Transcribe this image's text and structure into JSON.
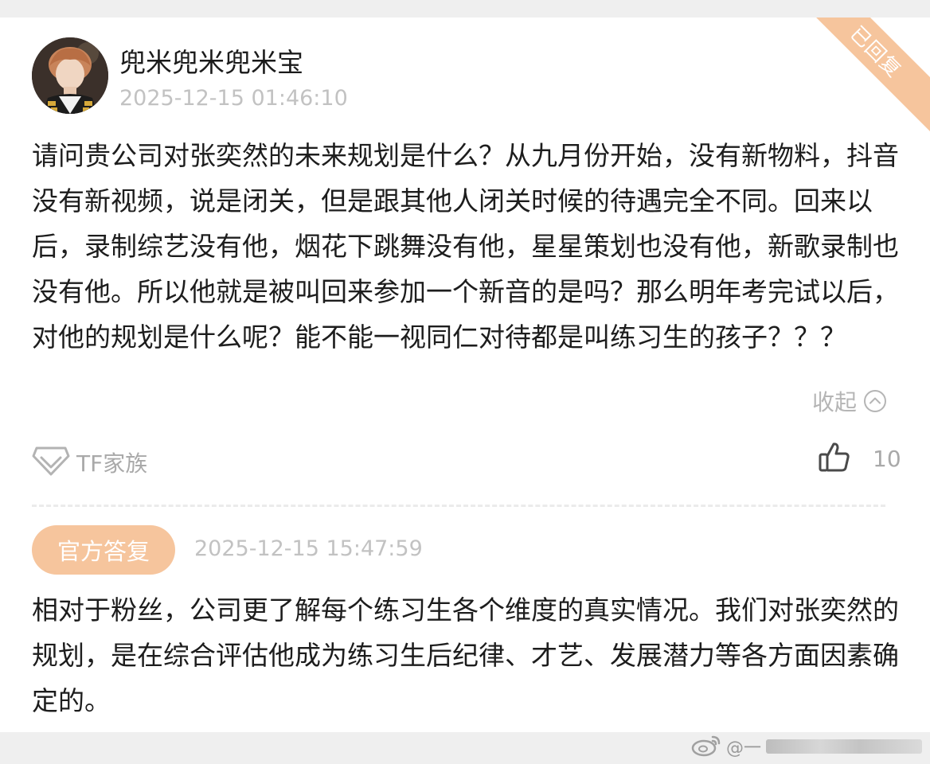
{
  "post": {
    "username": "兜米兜米兜米宝",
    "timestamp": "2025-12-15 01:46:10",
    "status_ribbon": "已回复",
    "question": "请问贵公司对张奕然的未来规划是什么？从九月份开始，没有新物料，抖音没有新视频，说是闭关，但是跟其他人闭关时候的待遇完全不同。回来以后，录制综艺没有他，烟花下跳舞没有他，星星策划也没有他，新歌录制也没有他。所以他就是被叫回来参加一个新音的是吗？那么明年考完试以后，对他的规划是什么呢？能不能一视同仁对待都是叫练习生的孩子？？？",
    "collapse_label": "收起",
    "tag_label": "TF家族",
    "like_count": "10"
  },
  "official_reply": {
    "badge": "官方答复",
    "timestamp": "2025-12-15 15:47:59",
    "text": "相对于粉丝，公司更了解每个练习生各个维度的真实情况。我们对张奕然的规划，是在综合评估他成为练习生后纪律、才艺、发展潜力等各方面因素确定的。"
  },
  "watermark": {
    "text": "@一"
  },
  "icons": {
    "avatar": "avatar-photo",
    "collapse": "chevron-up-circle-icon",
    "tag": "diamond-tag-icon",
    "like": "thumbs-up-icon",
    "watermark": "weibo-logo-icon"
  },
  "colors": {
    "accent": "#f6c59d",
    "text": "#1d1d1d",
    "muted": "#a9a9a9",
    "background": "#efefef"
  }
}
